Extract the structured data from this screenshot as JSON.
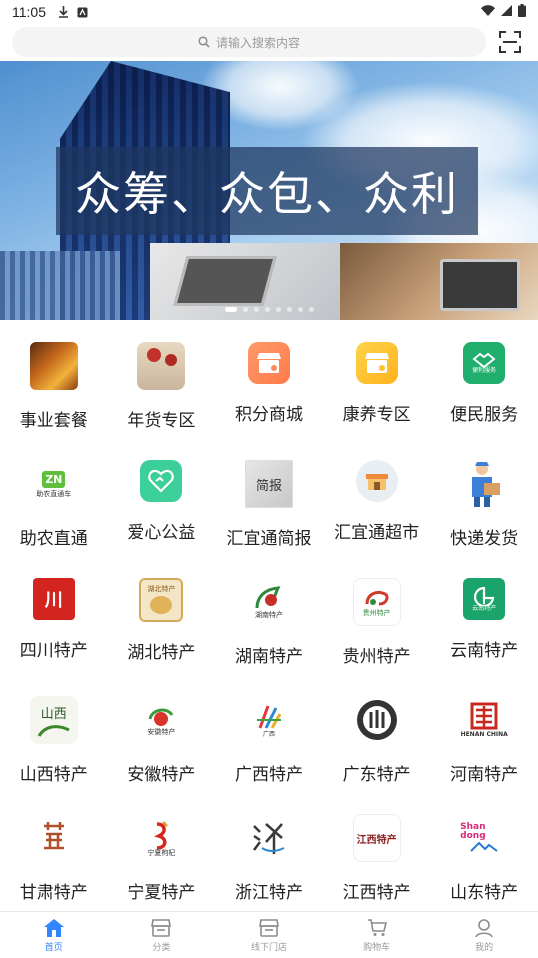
{
  "status_bar": {
    "time": "11:05"
  },
  "search": {
    "placeholder": "请输入搜索内容"
  },
  "banner": {
    "headline": "众筹、众包、众利",
    "slide_count": 8,
    "active_slide": 1
  },
  "grid": [
    {
      "label": "事业套餐",
      "icon": "food-icon"
    },
    {
      "label": "年货专区",
      "icon": "new-year-goods-icon"
    },
    {
      "label": "积分商城",
      "icon": "points-mall-icon"
    },
    {
      "label": "康养专区",
      "icon": "health-care-icon"
    },
    {
      "label": "便民服务",
      "icon": "convenience-service-icon",
      "logo_text": "便利服务"
    },
    {
      "label": "助农直通",
      "icon": "farm-aid-icon",
      "logo_text": "ZN",
      "logo_sub": "助农直通车"
    },
    {
      "label": "爱心公益",
      "icon": "charity-heart-icon"
    },
    {
      "label": "汇宜通简报",
      "icon": "briefing-icon",
      "logo_text": "简报"
    },
    {
      "label": "汇宜通超市",
      "icon": "supermarket-icon"
    },
    {
      "label": "快递发货",
      "icon": "courier-icon"
    },
    {
      "label": "四川特产",
      "icon": "sichuan-specialty-icon",
      "logo_text": "川"
    },
    {
      "label": "湖北特产",
      "icon": "hubei-specialty-icon",
      "logo_text": "湖北特产"
    },
    {
      "label": "湖南特产",
      "icon": "hunan-specialty-icon",
      "logo_text": "湖南特产"
    },
    {
      "label": "贵州特产",
      "icon": "guizhou-specialty-icon",
      "logo_text": "贵州特产"
    },
    {
      "label": "云南特产",
      "icon": "yunnan-specialty-icon",
      "logo_text": "云南特产"
    },
    {
      "label": "山西特产",
      "icon": "shanxi-specialty-icon",
      "logo_text": "山西"
    },
    {
      "label": "安徽特产",
      "icon": "anhui-specialty-icon",
      "logo_text": "安徽特产"
    },
    {
      "label": "广西特产",
      "icon": "guangxi-specialty-icon",
      "logo_text": "广西"
    },
    {
      "label": "广东特产",
      "icon": "guangdong-specialty-icon"
    },
    {
      "label": "河南特产",
      "icon": "henan-specialty-icon",
      "logo_text": "HENAN CHINA"
    },
    {
      "label": "甘肃特产",
      "icon": "gansu-specialty-icon"
    },
    {
      "label": "宁夏特产",
      "icon": "ningxia-specialty-icon",
      "logo_text": "宁夏枸杞"
    },
    {
      "label": "浙江特产",
      "icon": "zhejiang-specialty-icon"
    },
    {
      "label": "江西特产",
      "icon": "jiangxi-specialty-icon",
      "logo_text": "江西特产"
    },
    {
      "label": "山东特产",
      "icon": "shandong-specialty-icon",
      "logo_text": "Shan dong"
    }
  ],
  "tabbar": [
    {
      "label": "首页",
      "icon": "home-icon",
      "active": true
    },
    {
      "label": "分类",
      "icon": "category-icon",
      "active": false
    },
    {
      "label": "线下门店",
      "icon": "store-icon",
      "active": false
    },
    {
      "label": "购物车",
      "icon": "cart-icon",
      "active": false
    },
    {
      "label": "我的",
      "icon": "profile-icon",
      "active": false
    }
  ],
  "colors": {
    "accent": "#2f86ff",
    "inactive": "#9a9a9a"
  }
}
